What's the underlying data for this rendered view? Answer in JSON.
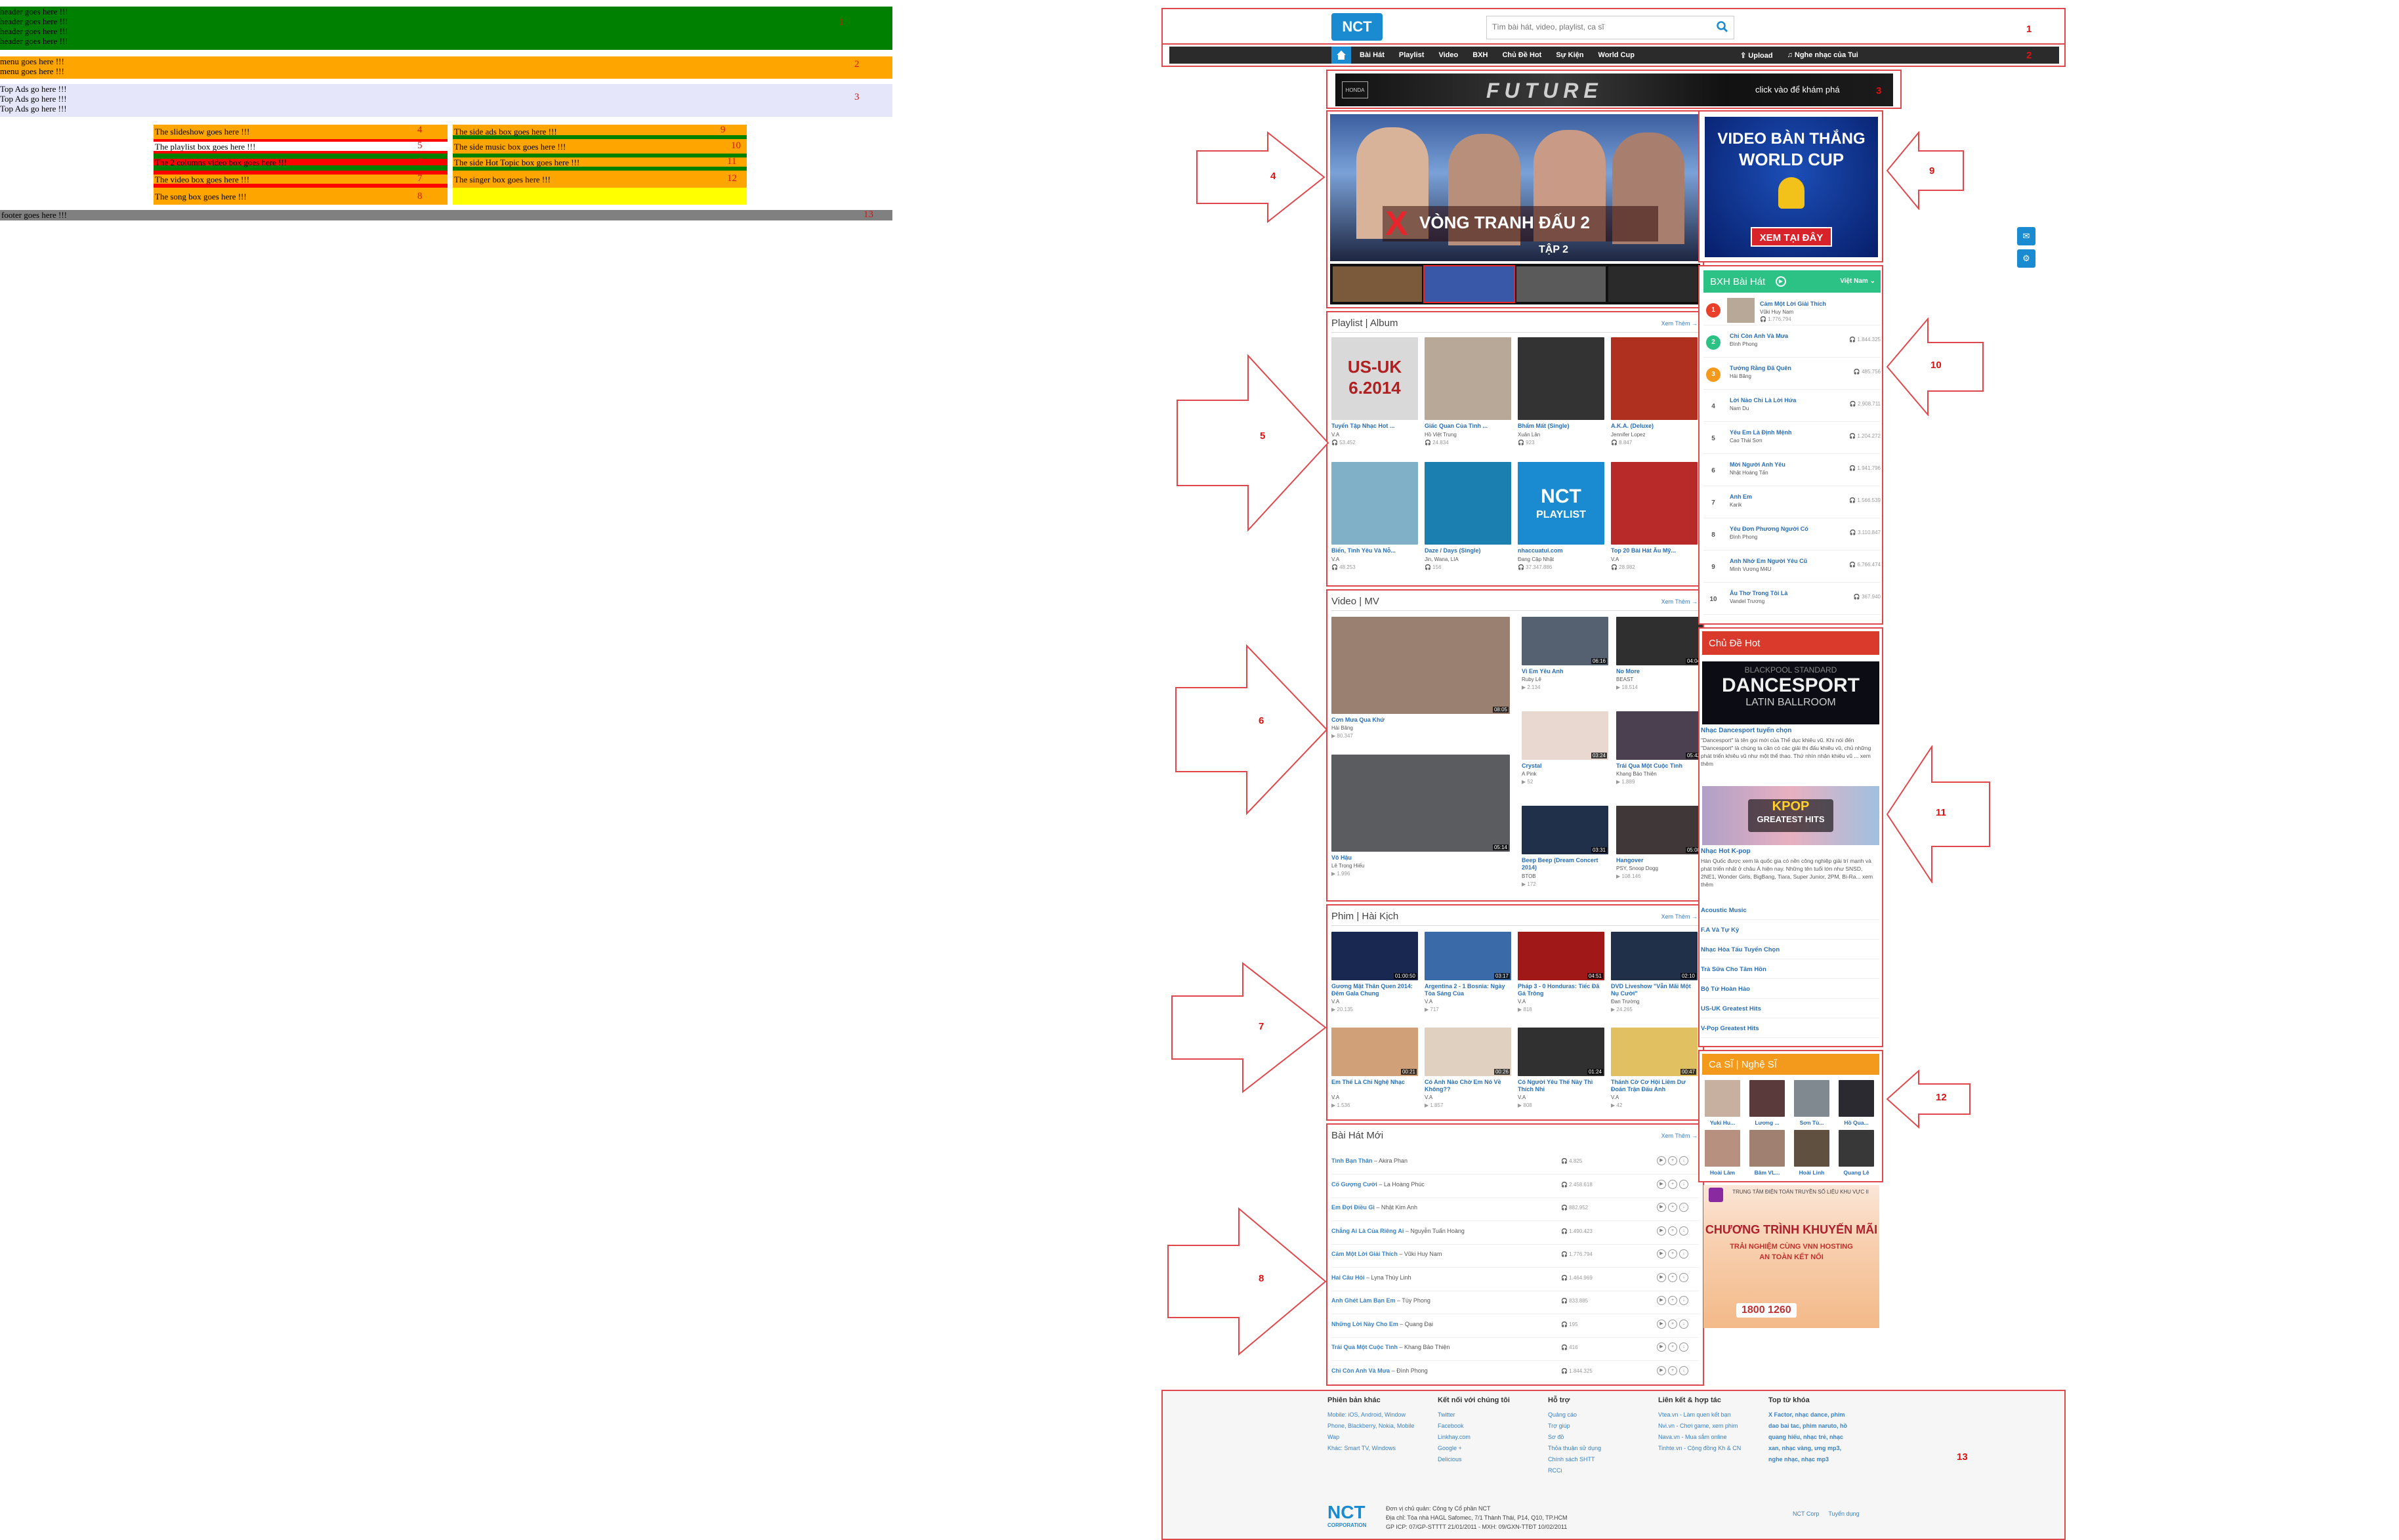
{
  "wireframe": {
    "header": {
      "lines": [
        "header goes here !!!",
        "header goes here !!!",
        "header goes here !!!",
        "header goes here !!!"
      ],
      "num": "1",
      "color": "#008000"
    },
    "menu": {
      "lines": [
        "menu goes here !!!",
        "menu goes here !!!"
      ],
      "num": "2",
      "color": "#ffa500"
    },
    "topads": {
      "lines": [
        "Top Ads go here !!!",
        "Top Ads go here !!!",
        "Top Ads go here !!!"
      ],
      "num": "3",
      "color": "#e6e6fa"
    },
    "left_boxes": [
      {
        "label": "The slideshow goes here !!!",
        "num": "4"
      },
      {
        "label": "The playlist box goes here !!!",
        "num": "5"
      },
      {
        "label": "The 2 columns video box goes here !!!",
        "num": "6"
      },
      {
        "label": "The video box goes here !!!",
        "num": "7"
      },
      {
        "label": "The song box goes here !!!",
        "num": "8"
      }
    ],
    "right_boxes": [
      {
        "label": "The side ads box goes here !!!",
        "num": "9"
      },
      {
        "label": "The side music box goes here !!!",
        "num": "10"
      },
      {
        "label": "The side Hot Topic box goes here !!!",
        "num": "11"
      },
      {
        "label": "The singer box goes here !!!",
        "num": "12"
      }
    ],
    "footer": {
      "label": "footer goes here !!!",
      "num": "13",
      "color": "#808080"
    }
  },
  "site": {
    "logo": "NCT",
    "search_placeholder": "Tìm bài hát, video, playlist, ca sĩ",
    "nav": [
      "Bài Hát",
      "Playlist",
      "Video",
      "BXH",
      "Chủ Đề Hot",
      "Sự Kiện",
      "World Cup"
    ],
    "nav_right": [
      "Upload",
      "Nghe nhạc của Tui"
    ],
    "banner_text": "click vào để khám phá",
    "banner_title": "FUTURE",
    "slide": {
      "subtitle": "VÒNG TRANH ĐẤU 2",
      "tap": "TẬP 2"
    },
    "side_ad": {
      "l1": "VIDEO BÀN THẮNG",
      "l2": "WORLD CUP",
      "button": "XEM TẠI ĐÂY"
    },
    "sections": {
      "playlist": {
        "title": "Playlist | Album",
        "more": "Xem Thêm →"
      },
      "video": {
        "title": "Video | MV",
        "more": "Xem Thêm →"
      },
      "film": {
        "title": "Phim | Hài Kịch",
        "more": "Xem Thêm →"
      },
      "songs": {
        "title": "Bài Hát Mới",
        "more": "Xem Thêm →"
      }
    },
    "playlists": [
      {
        "t": "Tuyển Tập Nhạc Hot ...",
        "a": "V.A",
        "v": "53.452",
        "c": "#d9d9d9"
      },
      {
        "t": "Giấc Quan Của Tình ...",
        "a": "Hồ Việt Trung",
        "v": "24.834",
        "c": "#b8a898"
      },
      {
        "t": "Bhẩm Mất (Single)",
        "a": "Xuân Lân",
        "v": "923",
        "c": "#333333"
      },
      {
        "t": "A.K.A. (Deluxe)",
        "a": "Jennifer Lopez",
        "v": "8.847",
        "c": "#b03020"
      },
      {
        "t": "Biển, Tình Yêu Và Nỗ...",
        "a": "V.A",
        "v": "48.253",
        "c": "#7fb0c8"
      },
      {
        "t": "Daze / Days (Single)",
        "a": "Jin, Wana, LIA",
        "v": "156",
        "c": "#1b7fb0"
      },
      {
        "t": "nhaccuatui.com",
        "a": "Đang Cập Nhật",
        "v": "37.347.886",
        "c": "#1a8bd0"
      },
      {
        "t": "Top 20 Bài Hát Âu Mỹ...",
        "a": "V.A",
        "v": "28.982",
        "c": "#b82a2a"
      }
    ],
    "playlist_badges": {
      "uk": "US-UK",
      "year": "6.2014",
      "nct": "NCT",
      "pl": "PLAYLIST"
    },
    "videos_big": [
      {
        "t": "Cơn Mưa Qua Khứ",
        "a": "Hải Băng",
        "v": "80.347",
        "d": "08:05"
      },
      {
        "t": "Vô Hậu",
        "a": "Lê Trọng Hiếu",
        "v": "1.996",
        "d": "05:14"
      }
    ],
    "videos_small": [
      {
        "t": "Vì Em Yêu Anh",
        "a": "Ruby Lê",
        "v": "2.134",
        "d": "06:16",
        "c": "#556070"
      },
      {
        "t": "No More",
        "a": "BEAST",
        "v": "18.514",
        "d": "04:04",
        "c": "#2f2f2f"
      },
      {
        "t": "Crystal",
        "a": "A Pink",
        "v": "52",
        "d": "03:24",
        "c": "#e8d8d0"
      },
      {
        "t": "Trái Qua Một Cuộc Tình",
        "a": "Khang Bảo Thiện",
        "v": "1.889",
        "d": "05:42",
        "c": "#4a4050"
      },
      {
        "t": "Beep Beep (Dream Concert 2014)",
        "a": "BTOB",
        "v": "172",
        "d": "03:31",
        "c": "#20304a"
      },
      {
        "t": "Hangover",
        "a": "PSY, Snoop Dogg",
        "v": "108.146",
        "d": "05:08",
        "c": "#403838"
      }
    ],
    "films": [
      {
        "t": "Gương Mặt Thân Quen 2014: Đêm Gala Chung",
        "a": "V.A",
        "v": "20.135",
        "d": "01:00:50",
        "c": "#182850"
      },
      {
        "t": "Argentina 2 - 1 Bosnia: Ngày Tỏa Sáng Của",
        "a": "V.A",
        "v": "717",
        "d": "03:17",
        "c": "#3a6aa8"
      },
      {
        "t": "Pháp 3 - 0 Honduras: Tiếc Đã Gá Trông",
        "a": "V.A",
        "v": "818",
        "d": "04:51",
        "c": "#a01818"
      },
      {
        "t": "DVD Liveshow \"Vẫn Mãi Một Nụ Cười\"",
        "a": "Đan Trường",
        "v": "24.265",
        "d": "02:10",
        "c": "#203048"
      },
      {
        "t": "Em Thế Là Chỉ Nghệ Nhạc",
        "a": "V.A",
        "v": "1.536",
        "d": "00:21",
        "c": "#d0a078"
      },
      {
        "t": "Có Anh Nào Chờ Em Nó Về Không??",
        "a": "V.A",
        "v": "1.857",
        "d": "00:26",
        "c": "#e0d0c0"
      },
      {
        "t": "Có Người Yêu Thế Này Thì Thích Nhỉ",
        "a": "V.A",
        "v": "808",
        "d": "01:24",
        "c": "#303030"
      },
      {
        "t": "Thánh Cờ Cơ Hội Liêm Dư Đoán Trận Đấu Anh",
        "a": "V.A",
        "v": "42",
        "d": "00:47",
        "c": "#e0c060"
      }
    ],
    "songs": [
      {
        "t": "Tình Bạn Thân",
        "a": "Akira Phan",
        "v": "4.825"
      },
      {
        "t": "Cố Gượng Cười",
        "a": "La Hoàng Phúc",
        "v": "2.458.618"
      },
      {
        "t": "Em Đợi Điều Gì",
        "a": "Nhật Kim Anh",
        "v": "882.952"
      },
      {
        "t": "Chẳng Ai Là Của Riêng Ai",
        "a": "Nguyễn Tuấn Hoàng",
        "v": "1.490.423"
      },
      {
        "t": "Cảm Một Lời Giải Thích",
        "a": "Vũki Huy Nam",
        "v": "1.776.794"
      },
      {
        "t": "Hai Câu Hỏi",
        "a": "Lyna Thùy Linh",
        "v": "1.464.969"
      },
      {
        "t": "Anh Ghét Làm Bạn Em",
        "a": "Tùy Phong",
        "v": "833.885"
      },
      {
        "t": "Những Lời Này Cho Em",
        "a": "Quang Đại",
        "v": "195"
      },
      {
        "t": "Trái Qua Một Cuộc Tình",
        "a": "Khang Bảo Thiện",
        "v": "416"
      },
      {
        "t": "Chỉ Còn Anh Và Mưa",
        "a": "Đình Phong",
        "v": "1.844.325"
      }
    ],
    "chart": {
      "title": "BXH Bài Hát",
      "region": "Việt Nam",
      "items": [
        {
          "n": "1",
          "t": "Cảm Một Lời Giải Thích",
          "a": "Vũki Huy Nam",
          "v": "1.776.794"
        },
        {
          "n": "2",
          "t": "Chỉ Còn Anh Và Mưa",
          "a": "Đình Phong",
          "v": "1.844.325"
        },
        {
          "n": "3",
          "t": "Tưởng Rằng Đã Quên",
          "a": "Hải Băng",
          "v": "485.756"
        },
        {
          "n": "4",
          "t": "Lời Nào Chỉ Là Lời Hứa",
          "a": "Nam Du",
          "v": "2.908.711"
        },
        {
          "n": "5",
          "t": "Yêu Em Là Định Mệnh",
          "a": "Cao Thái Sơn",
          "v": "1.204.272"
        },
        {
          "n": "6",
          "t": "Mời Người Anh Yêu",
          "a": "Nhật Hoàng Tấn",
          "v": "1.941.796"
        },
        {
          "n": "7",
          "t": "Anh Em",
          "a": "Karik",
          "v": "1.566.539"
        },
        {
          "n": "8",
          "t": "Yêu Đơn Phương Người Có",
          "a": "Đình Phong",
          "v": "3.110.847"
        },
        {
          "n": "9",
          "t": "Anh Nhớ Em Người Yêu Cũ",
          "a": "Minh Vương M4U",
          "v": "6.766.474"
        },
        {
          "n": "10",
          "t": "Âu Thơ Trong Tôi Là",
          "a": "Vandel Trương",
          "v": "367.940"
        }
      ]
    },
    "hot": {
      "title": "Chủ Đề Hot",
      "f1": {
        "t": "Nhạc Dancesport tuyển chọn",
        "d": "\"Dancesport\" là tên gọi mới của Thể dục khiêu vũ. Khi nói đến \"Dancesport\" là chúng ta cần có các giải thi đấu khiêu vũ, chủ những phát triển khiêu vũ như một thể thao. Thứ nhìn nhận khiêu vũ ... xem thêm",
        "img": "DANCESPORT",
        "img2": "LATIN BALLROOM",
        "img0": "BLACKPOOL STANDARD"
      },
      "f2": {
        "t": "Nhạc Hot K-pop",
        "d": "Hàn Quốc được xem là quốc gia có nền công nghiệp giải trí mạnh và phát triển nhất ở châu Á hiện nay. Những tên tuổi lớn như SNSD, 2NE1, Wonder Girls, BigBang, Tiara, Super Junior, 2PM, Bi-Ra... xem thêm",
        "img": "KPOP",
        "img2": "GREATEST HITS"
      },
      "links": [
        "Acoustic Music",
        "F.A Và Tự Kỷ",
        "Nhạc Hòa Tấu Tuyển Chọn",
        "Trà Sữa Cho Tâm Hồn",
        "Bộ Tứ Hoàn Hảo",
        "US-UK Greatest Hits",
        "V-Pop Greatest Hits"
      ]
    },
    "singers": {
      "title": "Ca SĨ | Nghệ SĨ",
      "names": [
        "Yuki Hu...",
        "Lương ...",
        "Sơn Tù...",
        "Hồ Qua...",
        "Hoài Lâm",
        "Bâm VL...",
        "Hoài Linh",
        "Quang Lê"
      ]
    },
    "ad2": {
      "top": "TRUNG TÂM ĐIỆN TOÁN TRUYỀN SỐ LIỆU KHU VỰC II",
      "title": "CHƯƠNG TRÌNH KHUYẾN MÃI",
      "l1": "TRẢI NGHIỆM CÙNG VNN HOSTING",
      "l2": "AN TOÀN KẾT NỐI",
      "hotline": "1800 1260"
    },
    "footer": {
      "cols": [
        {
          "h": "Phiên bản khác",
          "items": [
            "Mobile: iOS, Android, Window",
            "Phone, Blackberry, Nokia, Mobile",
            "Wap",
            "Khác: Smart TV, Windows"
          ]
        },
        {
          "h": "Kết nối với chúng tôi",
          "items": [
            "Twitter",
            "Facebook",
            "Linkhay.com",
            "Google +",
            "Delicious"
          ]
        },
        {
          "h": "Hỗ trợ",
          "items": [
            "Quảng cáo",
            "Trợ giúp",
            "Sơ đồ",
            "Thỏa thuận sử dụng",
            "Chính sách SHTT",
            "RCCi"
          ]
        },
        {
          "h": "Liên kết & hợp tác",
          "items": [
            "Vtea.vn - Làm quen kết bạn",
            "Nvi.vn - Chơi game, xem phim",
            "Nava.vn - Mua sắm online",
            "Tinhte.vn - Cộng đồng Kh & CN"
          ]
        },
        {
          "h": "Top từ khóa",
          "items": [
            "X Factor, nhạc dance, phim",
            "dao bai tac, phim naruto, hồ",
            "quang hiếu, nhạc trẻ, nhạc",
            "xan, nhạc vàng, ưng mp3,",
            "nghe nhạc, nhạc mp3"
          ]
        }
      ],
      "company": "Đơn vị chủ quản: Công ty Cổ phần NCT",
      "addr": "Địa chỉ: Tòa nhà HAGL Safomec, 7/1 Thành Thái, P14, Q10, TP.HCM",
      "license": "GP ICP: 07/GP-STTTT 21/01/2011 - MXH: 09/GXN-TTĐT 10/02/2011",
      "corp": "NCT Corp",
      "jobs": "Tuyển dụng",
      "nctsub": "CORPORATION"
    }
  },
  "colors": {
    "nct_blue": "#1a8bd0",
    "wire_red": "#e0474c",
    "nav_dark": "#2b2b2b",
    "orange": "#f39a1d",
    "green": "#2cc185"
  }
}
